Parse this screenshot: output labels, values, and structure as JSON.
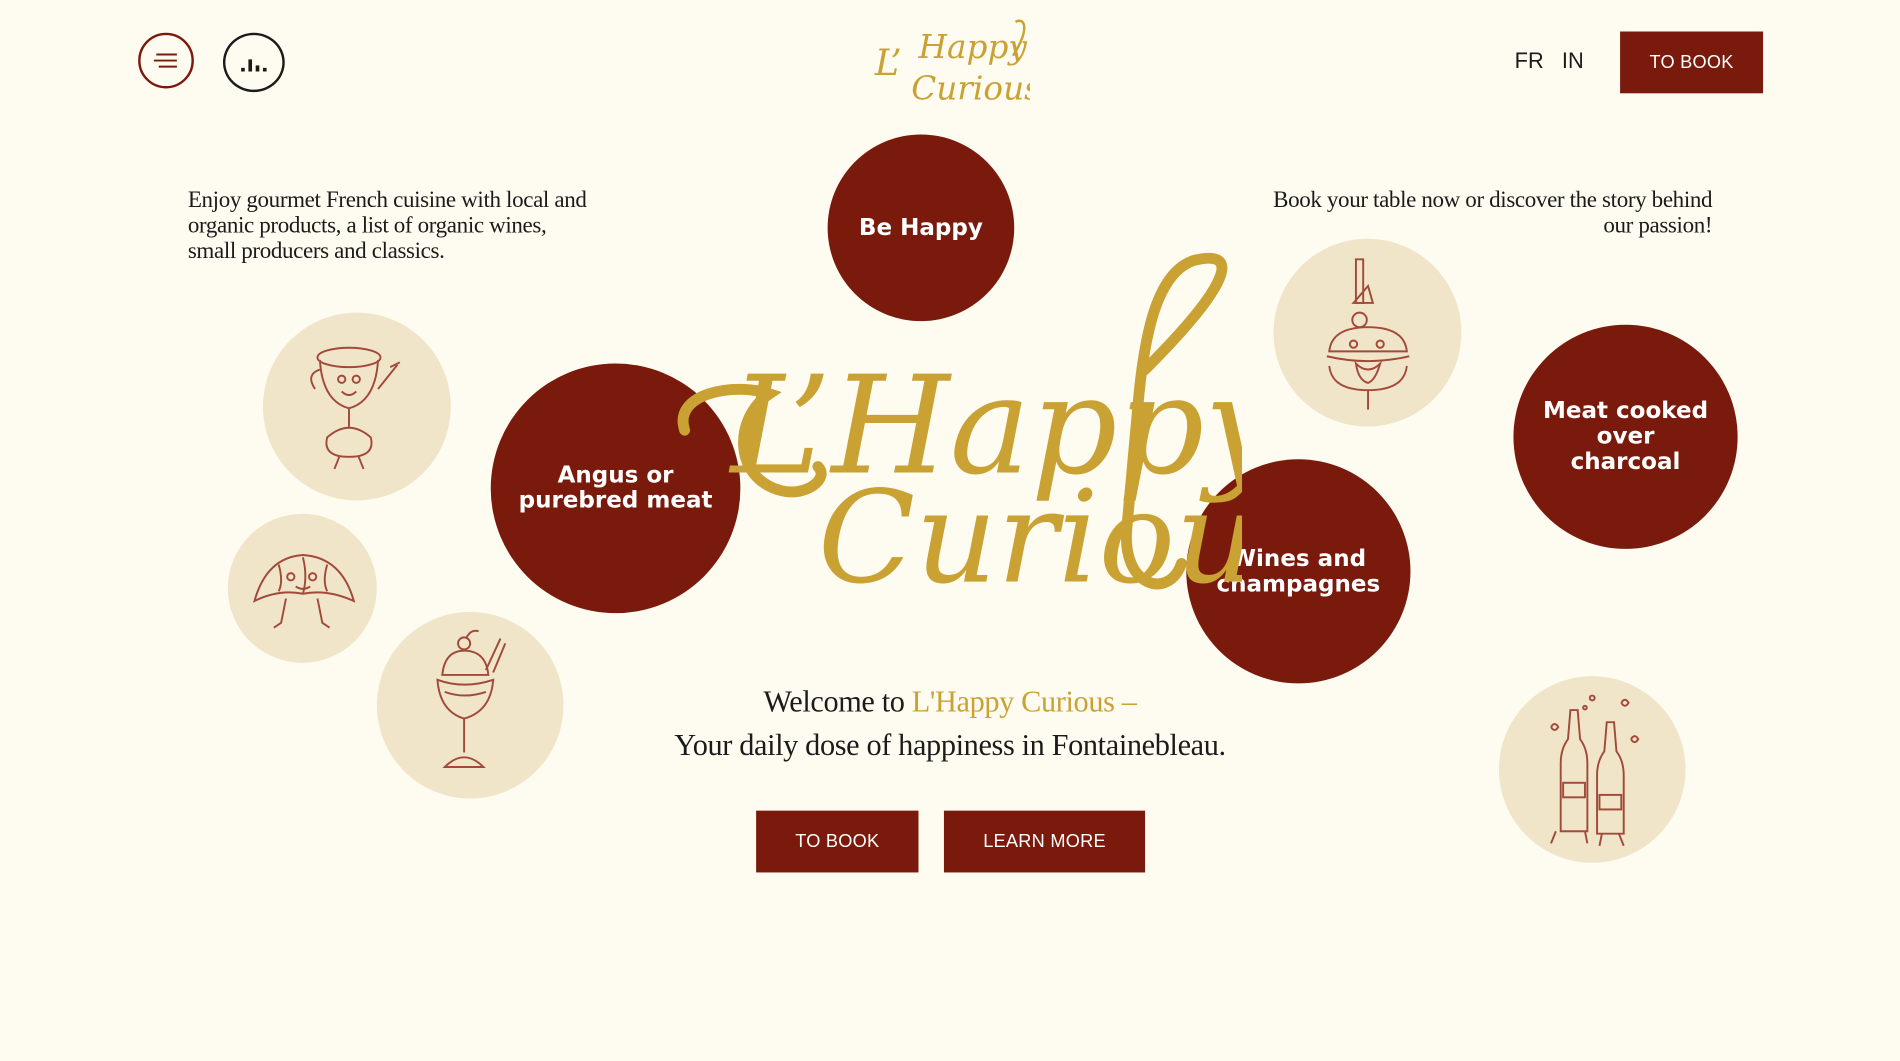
{
  "header": {
    "menu_icon": "hamburger-menu-icon",
    "sound_icon": "sound-bars-icon",
    "logo_icon": "lhappy-curious-logo",
    "languages": [
      "FR",
      "IN"
    ],
    "book_label": "TO BOOK"
  },
  "intro": {
    "left": "Enjoy gourmet French cuisine with local and organic products, a list of organic wines, small producers and classics.",
    "right": "Book your table now or discover the story behind our passion!"
  },
  "bubbles": {
    "be_happy": "Be Happy",
    "angus": "Angus or purebred meat",
    "meat_charcoal": "Meat cooked over charcoal",
    "wines": "Wines and champagnes"
  },
  "illustrations": [
    "coffee-cup-character-icon",
    "croissant-character-icon",
    "ice-cream-sundae-icon",
    "burger-character-icon",
    "champagne-bottles-icon"
  ],
  "welcome": {
    "prefix": "Welcome to ",
    "brand": "L'Happy Curious",
    "dash": " –",
    "tagline": "Your daily dose of happiness in Fontainebleau."
  },
  "cta": {
    "book_label": "TO BOOK",
    "more_label": "LEARN MORE"
  },
  "colors": {
    "background": "#fefbf1",
    "brand_red": "#7a1a0c",
    "gold": "#c9a233",
    "cream_circle": "#f0e5c9"
  }
}
